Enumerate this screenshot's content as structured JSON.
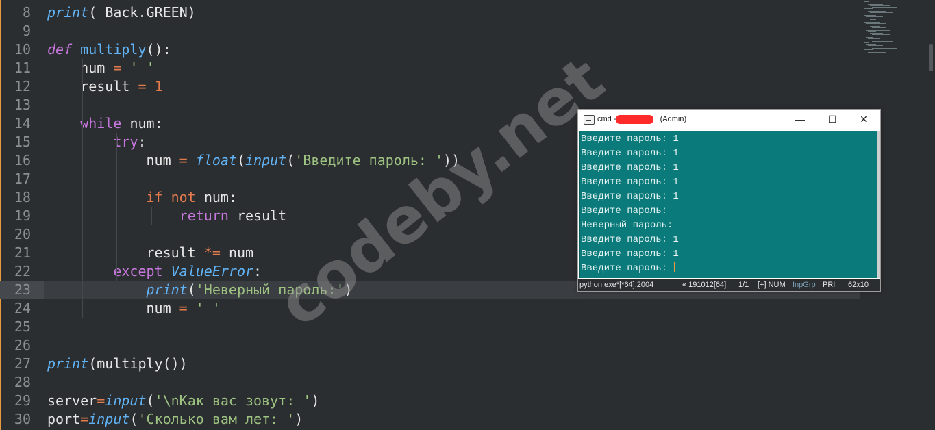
{
  "editor": {
    "current_line": "23",
    "lines": [
      {
        "n": "8",
        "t": "print( Back.GREEN)"
      },
      {
        "n": "9",
        "t": ""
      },
      {
        "n": "10",
        "t": "def multiply():"
      },
      {
        "n": "11",
        "t": "    num = ' '"
      },
      {
        "n": "12",
        "t": "    result = 1"
      },
      {
        "n": "13",
        "t": ""
      },
      {
        "n": "14",
        "t": "    while num:"
      },
      {
        "n": "15",
        "t": "        try:"
      },
      {
        "n": "16",
        "t": "            num = float(input('Введите пароль: '))"
      },
      {
        "n": "17",
        "t": ""
      },
      {
        "n": "18",
        "t": "            if not num:"
      },
      {
        "n": "19",
        "t": "                return result"
      },
      {
        "n": "20",
        "t": ""
      },
      {
        "n": "21",
        "t": "            result *= num"
      },
      {
        "n": "22",
        "t": "        except ValueError:"
      },
      {
        "n": "23",
        "t": "            print('Неверный пароль:')"
      },
      {
        "n": "24",
        "t": "            num = ' '"
      },
      {
        "n": "25",
        "t": ""
      },
      {
        "n": "26",
        "t": ""
      },
      {
        "n": "27",
        "t": "print(multiply())"
      },
      {
        "n": "28",
        "t": ""
      },
      {
        "n": "29",
        "t": "server=input('\\nКак вас зовут: ')"
      },
      {
        "n": "30",
        "t": "port=input('Сколько вам лет: ')"
      }
    ]
  },
  "console": {
    "title_prefix": "cmd - ",
    "title_suffix": " (Admin)",
    "buttons": {
      "minimize": "—",
      "maximize": "☐",
      "close": "✕"
    },
    "lines": [
      "Введите пароль: 1",
      "Введите пароль: 1",
      "Введите пароль: 1",
      "Введите пароль: 1",
      "Введите пароль: 1",
      "Введите пароль: ",
      "Неверный пароль:",
      "Введите пароль: 1",
      "Введите пароль: 1",
      "Введите пароль: "
    ],
    "status": {
      "process": "python.exe*[*64]:2004",
      "build": "« 191012[64]",
      "pos": "1/1",
      "flags": "[+] NUM",
      "inpgrp": "InpGrp",
      "pri": "PRI",
      "size": "62x10"
    }
  },
  "watermark": "codeby.net",
  "colors": {
    "background": "#2b2e31",
    "console_bg": "#0a7a7a",
    "keyword": "#c678dd",
    "function": "#61b3f5",
    "string": "#9dc281",
    "number": "#e37b4c",
    "accent": "#e89a3c"
  }
}
